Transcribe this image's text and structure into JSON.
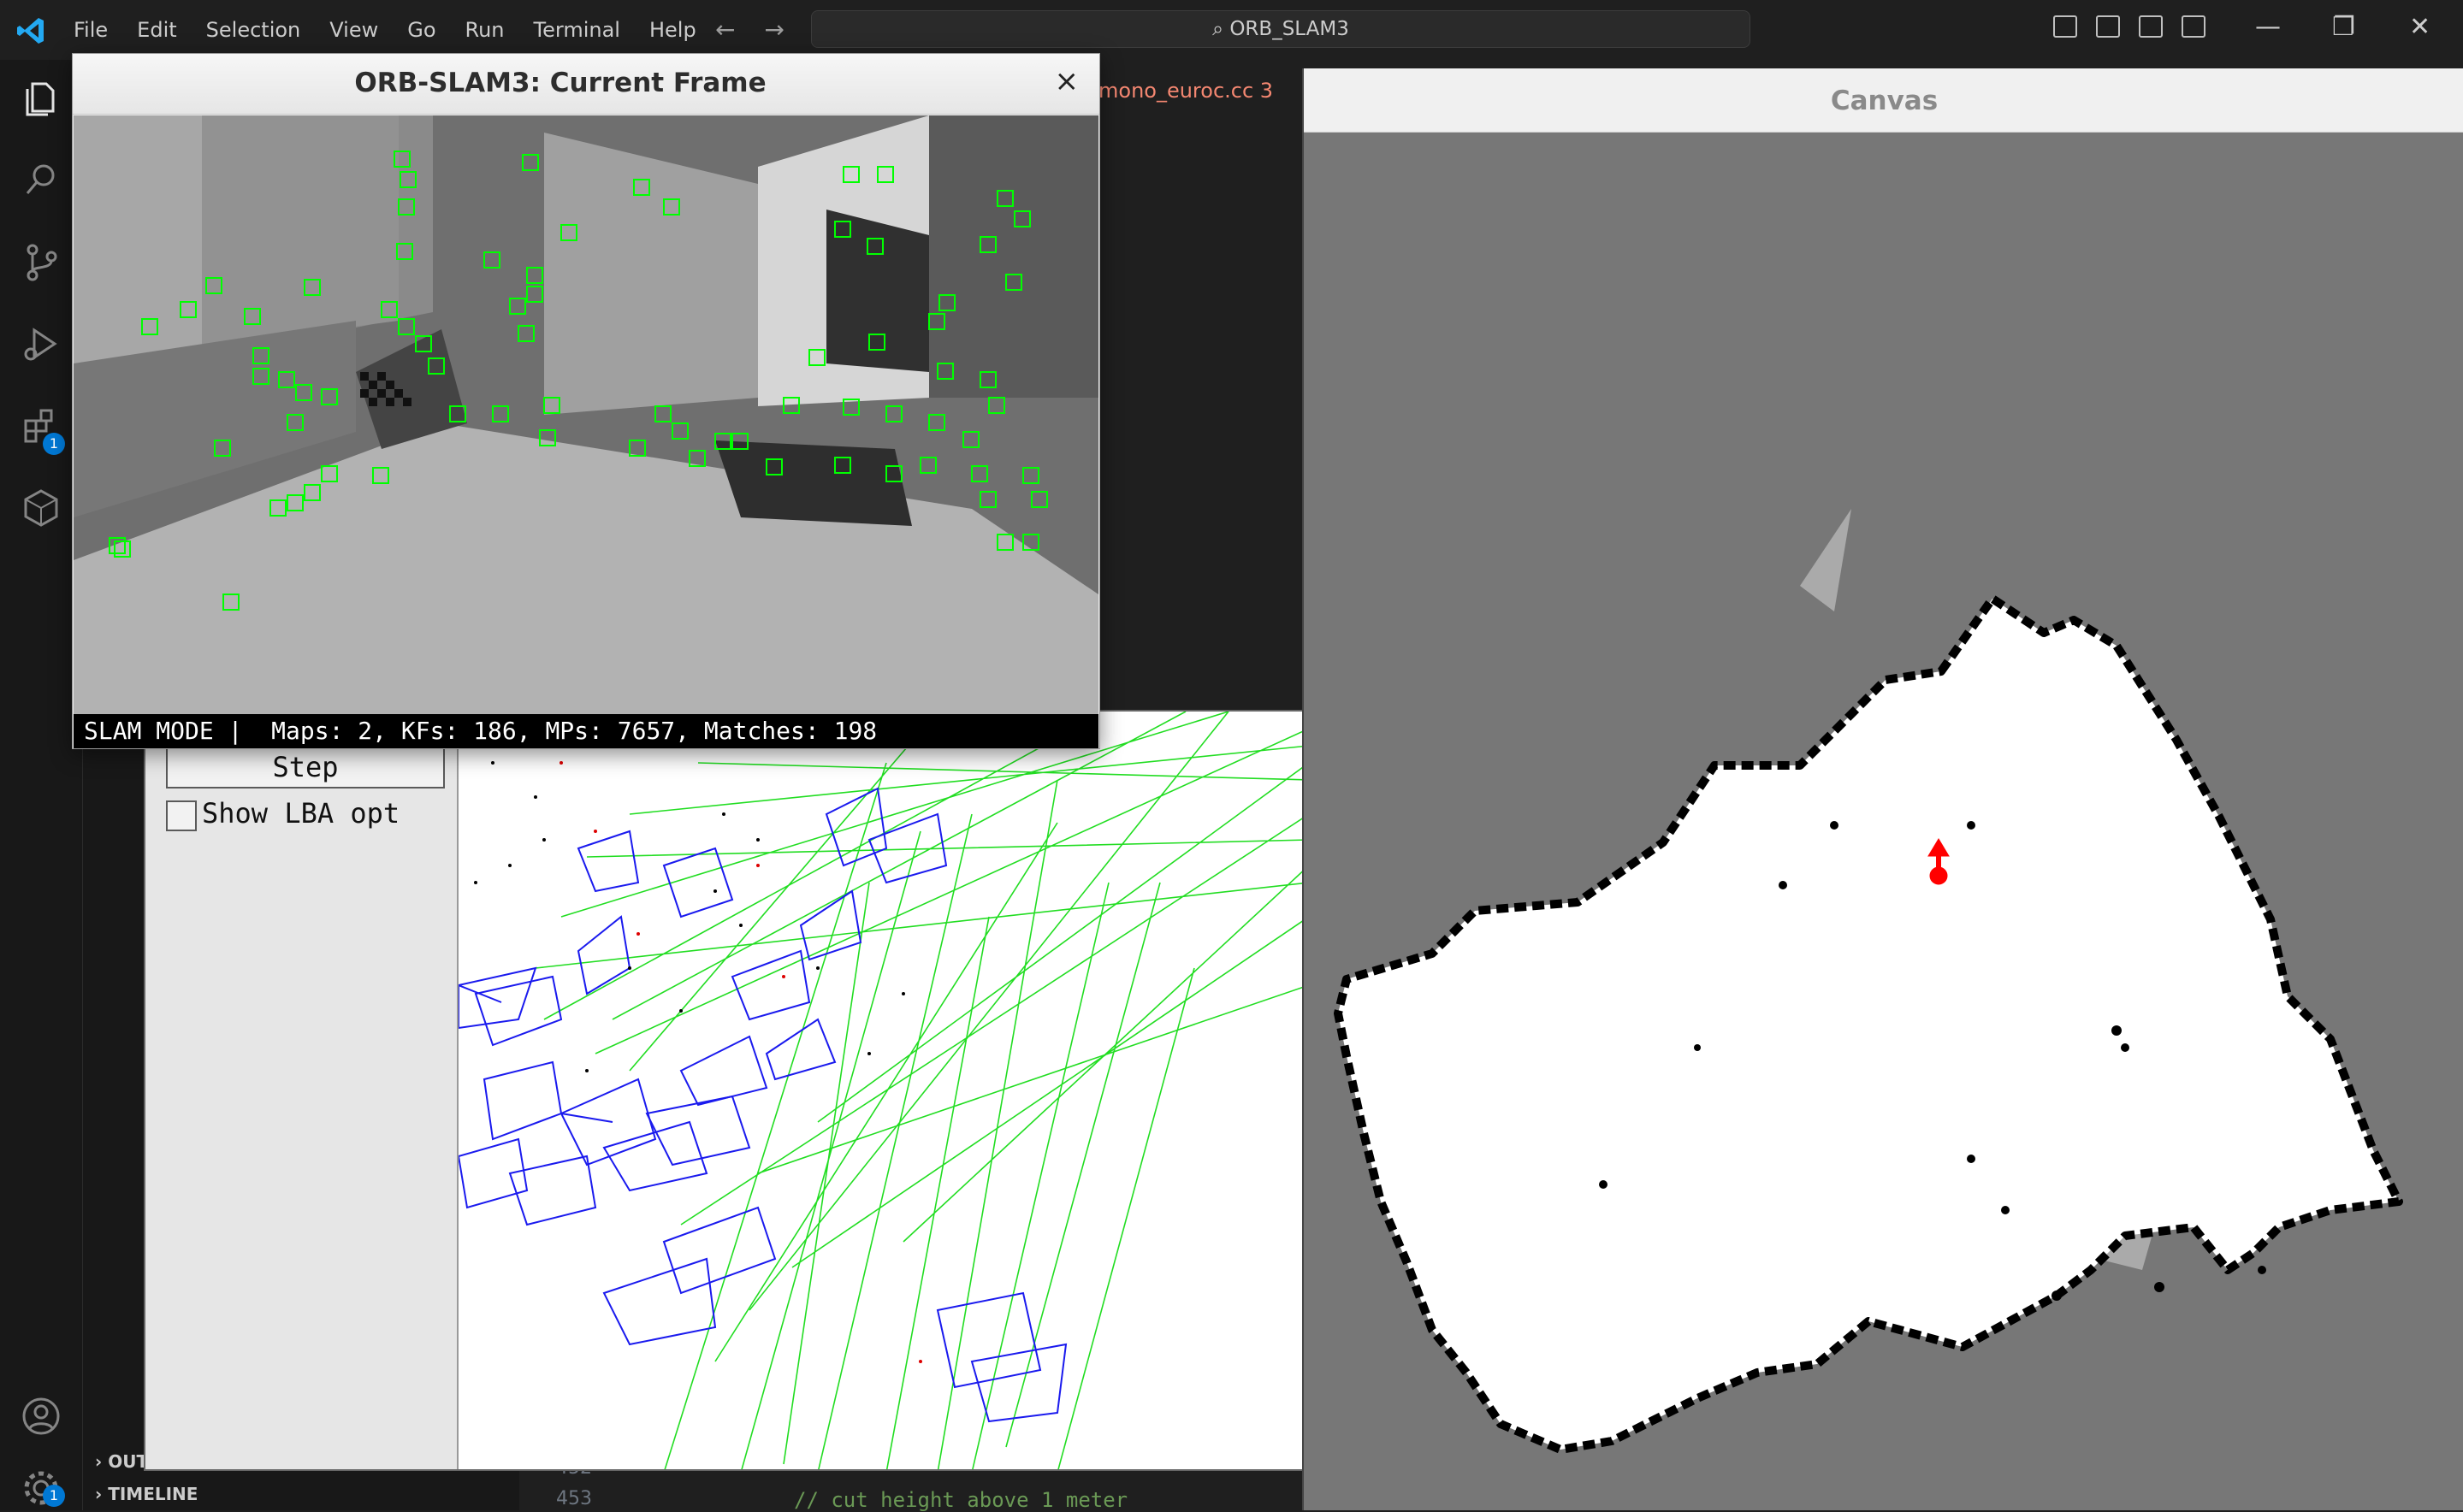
{
  "titlebar": {
    "menu": [
      "File",
      "Edit",
      "Selection",
      "View",
      "Go",
      "Run",
      "Terminal",
      "Help"
    ],
    "search_text": "ORB_SLAM3",
    "window_controls": [
      "—",
      "❐",
      "✕"
    ]
  },
  "activity_bar": {
    "items": [
      "explorer-icon",
      "search-icon",
      "source-control-icon",
      "run-debug-icon",
      "extensions-icon",
      "remote-icon"
    ],
    "extensions_badge": "1",
    "bottom": [
      "account-icon",
      "settings-icon"
    ],
    "settings_badge": "1"
  },
  "sidebar": {
    "sections": [
      "OUT",
      "TIMELINE"
    ]
  },
  "editor": {
    "tab_label": "mono_euroc.cc 3",
    "line_numbers": [
      "452",
      "453"
    ],
    "code_line": "// cut height above 1 meter"
  },
  "current_frame_window": {
    "title": "ORB-SLAM3: Current Frame",
    "close_label": "×",
    "status": "SLAM MODE |  Maps: 2, KFs: 186, MPs: 7657, Matches: 198"
  },
  "viewer_window": {
    "step_button": "Step",
    "show_lba_label": "Show LBA opt",
    "show_lba_checked": false
  },
  "canvas_window": {
    "title": "Canvas"
  },
  "colors": {
    "feature_box": "#00ff00",
    "keyframe": "#0000ff",
    "covisibility": "#00dd00",
    "robot_pose": "#ff0000",
    "unknown_cell": "#777777",
    "free_cell": "#ffffff",
    "occupied_cell": "#000000"
  }
}
